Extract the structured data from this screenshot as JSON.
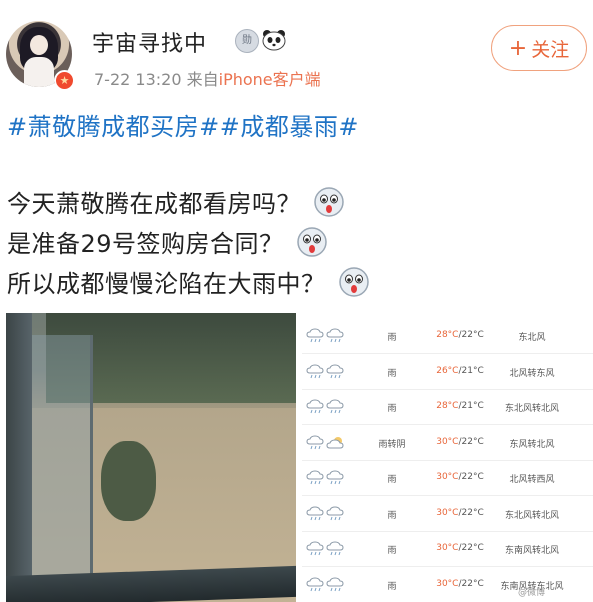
{
  "user": {
    "name": "宇宙寻找中",
    "time": "7-22 13:20",
    "source_prefix": "来自",
    "source": "iPhone客户端",
    "medal_label": "勋"
  },
  "follow_label": "关注",
  "post": {
    "tags": "#萧敬腾成都买房##成都暴雨#",
    "lines": [
      "今天萧敬腾在成都看房吗？",
      "是准备29号签购房合同？",
      "所以成都慢慢沦陷在大雨中？"
    ]
  },
  "weather": [
    {
      "cond": "雨",
      "hi": "28°C",
      "lo": "/22°C",
      "wind": "东北风",
      "icons": [
        "rain",
        "rain"
      ]
    },
    {
      "cond": "雨",
      "hi": "26°C",
      "lo": "/21°C",
      "wind": "北风转东风",
      "icons": [
        "rain",
        "rain"
      ]
    },
    {
      "cond": "雨",
      "hi": "28°C",
      "lo": "/21°C",
      "wind": "东北风转北风",
      "icons": [
        "rain",
        "rain"
      ]
    },
    {
      "cond": "雨转阴",
      "hi": "30°C",
      "lo": "/22°C",
      "wind": "东风转北风",
      "icons": [
        "rain",
        "cloud"
      ]
    },
    {
      "cond": "雨",
      "hi": "30°C",
      "lo": "/22°C",
      "wind": "北风转西风",
      "icons": [
        "rain",
        "rain"
      ]
    },
    {
      "cond": "雨",
      "hi": "30°C",
      "lo": "/22°C",
      "wind": "东北风转北风",
      "icons": [
        "rain",
        "rain"
      ]
    },
    {
      "cond": "雨",
      "hi": "30°C",
      "lo": "/22°C",
      "wind": "东南风转北风",
      "icons": [
        "rain",
        "rain"
      ]
    },
    {
      "cond": "雨",
      "hi": "30°C",
      "lo": "/22°C",
      "wind": "东南风转东北风",
      "icons": [
        "rain",
        "rain"
      ]
    }
  ],
  "watermark": "@微博"
}
